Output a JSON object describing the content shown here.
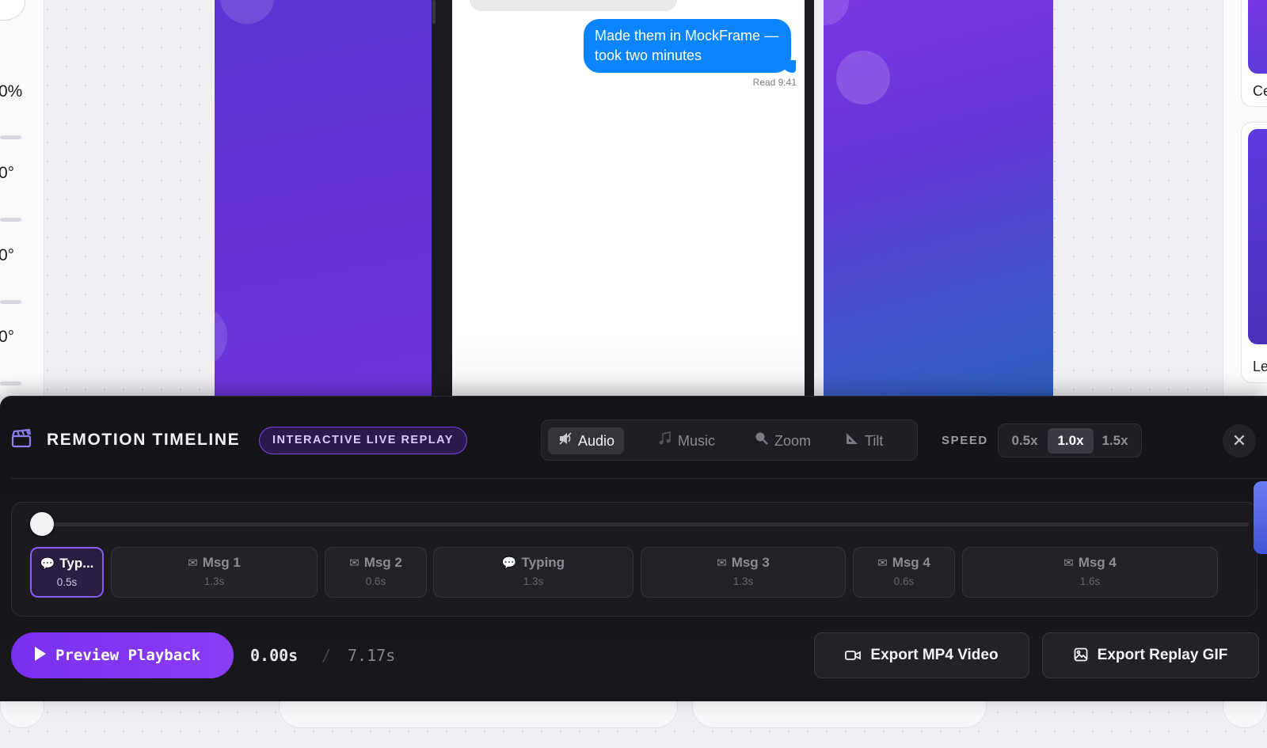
{
  "left_panel": {
    "values": [
      "0%",
      "0°",
      "0°",
      "0°"
    ]
  },
  "phone": {
    "message": "Made them in MockFrame — took two minutes",
    "read_receipt": "Read 9:41"
  },
  "right_panel": {
    "labels": [
      "Ce",
      "Le"
    ]
  },
  "timeline": {
    "title": "REMOTION TIMELINE",
    "badge": "INTERACTIVE LIVE REPLAY",
    "effects": [
      {
        "label": "Audio",
        "icon": "speaker-icon",
        "active": true
      },
      {
        "label": "Music",
        "icon": "music-note-icon",
        "active": false
      },
      {
        "label": "Zoom",
        "icon": "magnifier-icon",
        "active": false
      },
      {
        "label": "Tilt",
        "icon": "triangle-ruler-icon",
        "active": false
      }
    ],
    "speed_label": "SPEED",
    "speeds": [
      "0.5x",
      "1.0x",
      "1.5x"
    ],
    "speed_selected": "1.0x",
    "close_symbol": "✕",
    "clips": [
      {
        "label": "Typ...",
        "duration": "0.5s",
        "icon": "speech-bubble-icon",
        "active": true
      },
      {
        "label": "Msg 1",
        "duration": "1.3s",
        "icon": "envelope-icon",
        "active": false
      },
      {
        "label": "Msg 2",
        "duration": "0.6s",
        "icon": "envelope-icon",
        "active": false
      },
      {
        "label": "Typing",
        "duration": "1.3s",
        "icon": "speech-bubble-icon",
        "active": false
      },
      {
        "label": "Msg 3",
        "duration": "1.3s",
        "icon": "envelope-icon",
        "active": false
      },
      {
        "label": "Msg 4",
        "duration": "0.6s",
        "icon": "envelope-icon",
        "active": false
      },
      {
        "label": "Msg 4",
        "duration": "1.6s",
        "icon": "envelope-icon",
        "active": false
      }
    ],
    "playback_progress": 0,
    "preview_label": "Preview Playback",
    "time_current": "0.00s",
    "time_separator": "/",
    "time_total": "7.17s",
    "export_mp4": "Export MP4 Video",
    "export_gif": "Export Replay GIF",
    "colors": {
      "accent": "#7b2ff0",
      "active_clip_border": "#8b5cf6",
      "imessage_blue": "#0a84ff"
    }
  }
}
